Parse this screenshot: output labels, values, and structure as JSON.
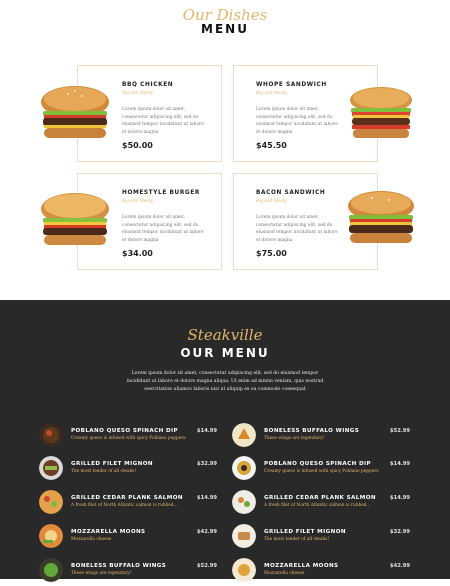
{
  "top_section": {
    "script_title": "Our Dishes",
    "title": "MENU",
    "cards": [
      {
        "title": "BBQ CHICKEN",
        "subtitle": "Big and Meaty",
        "description": "Lorem ipsum dolor sit amet, consectetur adipiscing elit, sed do eiusmod tempor incididunt ut labore et dolore magna",
        "price": "$50.00"
      },
      {
        "title": "WHOPE SANDWICH",
        "subtitle": "Big and Meaty",
        "description": "Lorem ipsum dolor sit amet, consectetur adipiscing elit, sed do eiusmod tempor incididunt ut labore et dolore magna",
        "price": "$45.50"
      },
      {
        "title": "HOMESTYLE BURGER",
        "subtitle": "Big and Meaty",
        "description": "Lorem ipsum dolor sit amet, consectetur adipiscing elit, sed do eiusmod tempor incididunt ut labore et dolore magna",
        "price": "$34.00"
      },
      {
        "title": "BACON SANDWICH",
        "subtitle": "Big and Meaty",
        "description": "Lorem ipsum dolor sit amet, consectetur adipiscing elit, sed do eiusmod tempor incididunt ut labore et dolore magna",
        "price": "$75.00"
      }
    ]
  },
  "dark_section": {
    "script_title": "Steakville",
    "title": "OUR MENU",
    "intro": "Lorem ipsum dolor sit amet, consectetur adipiscing elit, sed do eiusmod tempor incididunt ut labore et dolore magna aliqua. Ut enim ad minim veniam, quis nostrud exercitation ullamco laboris nisi ut aliquip ex ea commodo consequat",
    "left_items": [
      {
        "name": "POBLANO QUESO SPINACH DIP",
        "description": "Creamy queso is infused with spicy Poblano peppers",
        "price": "$14.99"
      },
      {
        "name": "GRILLED FILET MIGNON",
        "description": "The most tender of all steaks!",
        "price": "$32.99"
      },
      {
        "name": "GRILLED CEDAR PLANK SALMON",
        "description": "A fresh filet of North Atlantic salmon is rubbed...",
        "price": "$14.99"
      },
      {
        "name": "MOZZARELLA MOONS",
        "description": "Mozzarella cheese",
        "price": "$42.99"
      },
      {
        "name": "BONELESS BUFFALO WINGS",
        "description": "These wings are legendary!",
        "price": "$52.99"
      }
    ],
    "right_items": [
      {
        "name": "BONELESS BUFFALO WINGS",
        "description": "These wings are legendary!",
        "price": "$52.99"
      },
      {
        "name": "POBLANO QUESO SPINACH DIP",
        "description": "Creamy queso is infused with spicy Poblano peppers",
        "price": "$14.99"
      },
      {
        "name": "GRILLED CEDAR PLANK SALMON",
        "description": "A fresh filet of North Atlantic salmon is rubbed...",
        "price": "$14.99"
      },
      {
        "name": "GRILLED FILET MIGNON",
        "description": "The most tender of all steaks!",
        "price": "$32.99"
      },
      {
        "name": "MOZZARELLA MOONS",
        "description": "Mozzarella cheese",
        "price": "$42.99"
      }
    ]
  },
  "colors": {
    "accent": "#e3b46b",
    "dark_bg": "#292929"
  }
}
